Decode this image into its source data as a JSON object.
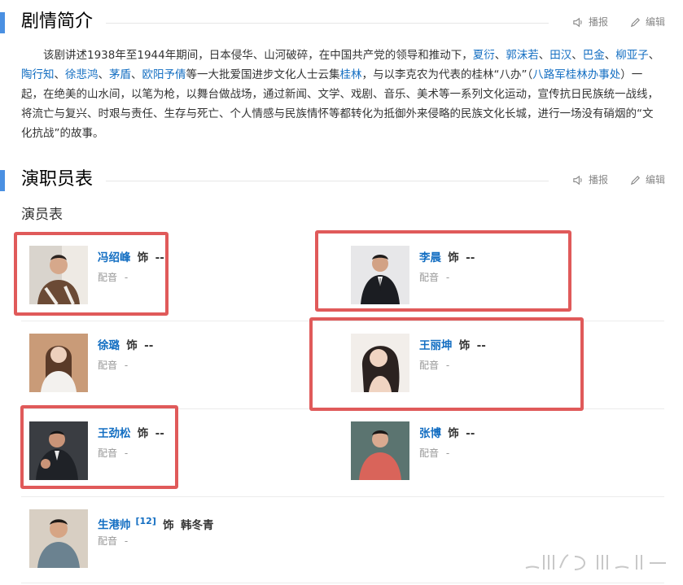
{
  "sections": {
    "synopsis": {
      "title": "剧情简介",
      "listen": "播报",
      "edit": "编辑"
    },
    "cast": {
      "title": "演职员表",
      "listen": "播报",
      "edit": "编辑"
    }
  },
  "summary": {
    "p1": "该剧讲述1938年至1944年期间，日本侵华、山河破碎，在中国共产党的领导和推动下，",
    "links1": [
      "夏衍",
      "郭沫若",
      "田汉",
      "巴金",
      "柳亚子",
      "陶行知",
      "徐悲鸿",
      "茅盾",
      "欧阳予倩"
    ],
    "sep": "、",
    "p2": "等一大批爱国进步文化人士云集",
    "link2": "桂林",
    "p3": "，与以李克农为代表的桂林“八办”（",
    "link3": "八路军桂林办事处",
    "p4": "）一起，在绝美的山水间，以笔为枪，以舞台做战场，通过新闻、文学、戏剧、音乐、美术等一系列文化运动，宣传抗日民族统一战线，将流亡与复兴、时艰与责任、生存与死亡、个人情感与民族情怀等都转化为抵御外来侵略的民族文化长城，进行一场没有硝烟的“文化抗战”的故事。"
  },
  "cast_table": {
    "subtitle": "演员表",
    "as_label": "饰",
    "dub_label": "配音",
    "members": [
      {
        "name": "冯绍峰",
        "role": "--",
        "dub": "-"
      },
      {
        "name": "李晨",
        "role": "--",
        "dub": "-"
      },
      {
        "name": "徐璐",
        "role": "--",
        "dub": "-"
      },
      {
        "name": "王丽坤",
        "role": "--",
        "dub": "-"
      },
      {
        "name": "王劲松",
        "role": "--",
        "dub": "-"
      },
      {
        "name": "张博",
        "role": "--",
        "dub": "-"
      },
      {
        "name": "生港帅",
        "ref": "[12]",
        "role": "韩冬青",
        "dub": "-"
      }
    ]
  },
  "colors": {
    "accent_bar": "#4a90e2",
    "link": "#136ec2",
    "highlight": "#e05a5a"
  }
}
